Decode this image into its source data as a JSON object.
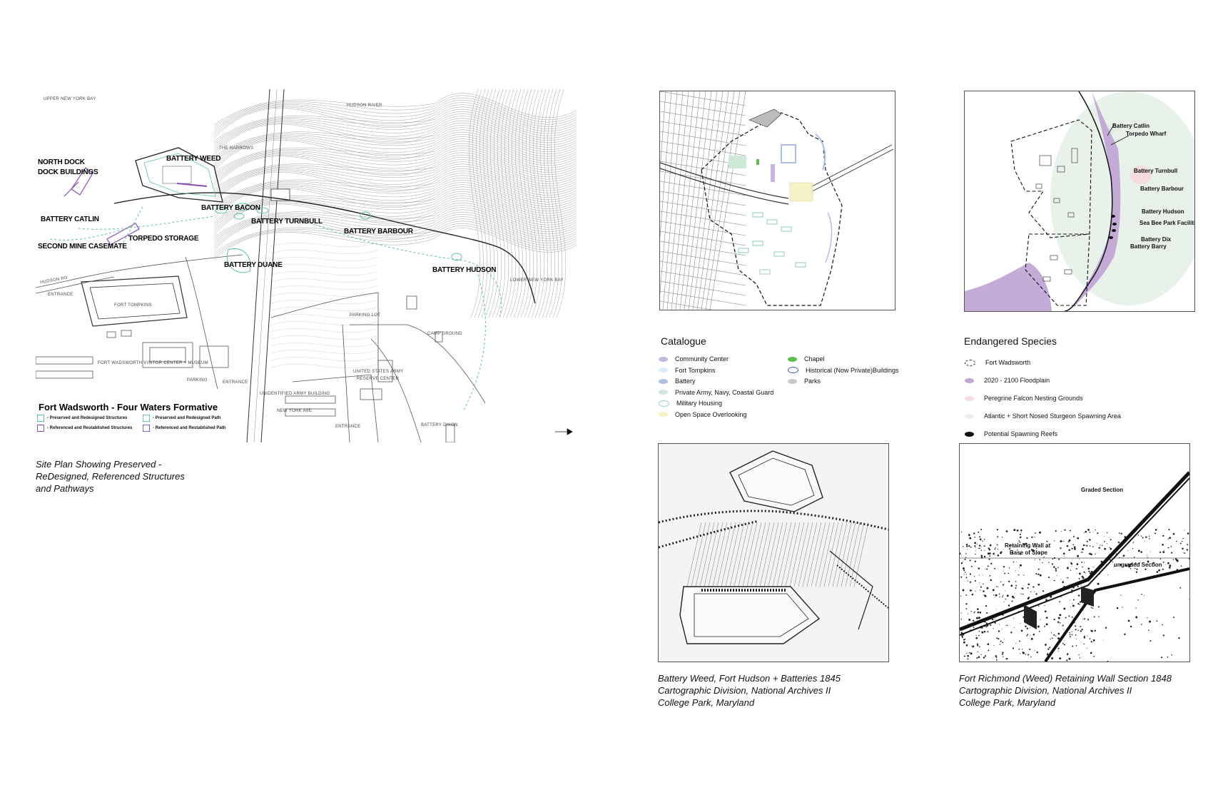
{
  "site_plan": {
    "title": "Fort Wadsworth - Four Waters Formative",
    "labels": {
      "north_dock": "NORTH DOCK",
      "dock_buildings": "DOCK BUILDINGS",
      "battery_weed": "BATTERY WEED",
      "battery_catlin": "BATTERY CATLIN",
      "battery_bacon": "BATTERY BACON",
      "battery_turnbull": "BATTERY TURNBULL",
      "battery_barbour": "BATTERY BARBOUR",
      "torpedo_storage": "TORPEDO STORAGE",
      "second_mine_casemate": "SECOND MINE CASEMATE",
      "battery_duane": "BATTERY DUANE",
      "battery_hudson": "BATTERY HUDSON"
    },
    "small_labels": {
      "upper_bay": "UPPER NEW YORK BAY",
      "hudson_river": "HUDSON RIVER",
      "the_narrows": "THE NARROWS",
      "lower_bay": "LOWER NEW YORK BAY",
      "hudson_rd": "HUDSON RD",
      "entrance_1": "ENTRANCE",
      "entrance_2": "ENTRANCE",
      "entrance_3": "ENTRANCE",
      "fort_tompkins": "FORT TOMPKINS",
      "parking_lot": "PARKING LOT",
      "camp_ground": "CAMP GROUND",
      "visitor_center": "FORT WADSWORTH VISITOR CENTER + MUSEUM",
      "parking": "PARKING",
      "unidentified_building": "UNIDENTIFIED ARMY BUILDING",
      "army_reserve_1": "UNITED STATES ARMY",
      "army_reserve_2": "RESERVE CENTER",
      "new_york_ave": "NEW YORK AVE",
      "battery_dixon": "BATTERY DIXON"
    },
    "legend": [
      {
        "label": "- Preserved and Redesigned Structures",
        "color": "#5fbfa0",
        "style": "solid"
      },
      {
        "label": "- Preserved and Redesigned Path",
        "color": "#5fbfa0",
        "style": "dashed"
      },
      {
        "label": "- Referenced and Restablished Structures",
        "color": "#8a4fb0",
        "style": "solid"
      },
      {
        "label": "- Referenced and Restablished Path",
        "color": "#8a4fb0",
        "style": "dashed"
      }
    ],
    "caption": [
      "Site Plan Showing Preserved -",
      "ReDesigned, Referenced Structures",
      "and Pathways"
    ]
  },
  "catalogue": {
    "title": "Catalogue",
    "items": [
      {
        "label": "Community Center",
        "color": "#c9b6dc"
      },
      {
        "label": "Fort Tompkins",
        "color": "#d7ecf8"
      },
      {
        "label": "Battery",
        "color": "#aebfe6"
      },
      {
        "label": "Private Army, Navy, Coastal Guard",
        "color": "#cfe9d9"
      },
      {
        "label": "Military Housing",
        "color": "#ffffff",
        "outline": "#8fcfad"
      },
      {
        "label": "Open Space Overlooking",
        "color": "#f7f3c8"
      },
      {
        "label": "Chapel",
        "color": "#5cbf4e"
      },
      {
        "label": "Historical (Now Private)Buildings",
        "color": "#ffffff",
        "outline": "#3a55b8"
      },
      {
        "label": "Parks",
        "color": "#c8c8c8"
      }
    ]
  },
  "species": {
    "title": "Endangered Species",
    "items": [
      {
        "label": "Fort Wadsworth",
        "color": "#ffffff",
        "outline": "#222222"
      },
      {
        "label": "2020 - 2100 Floodplain",
        "color": "#c2a6d6"
      },
      {
        "label": "Peregrine Falcon Nesting Grounds",
        "color": "#f6dce0"
      },
      {
        "label": "Atlantic + Short Nosed Sturgeon Spawning Area",
        "color": "#e8f1ea"
      },
      {
        "label": "Potential Spawning Reefs",
        "color": "#111111"
      }
    ],
    "map_labels": {
      "catlin": "Battery Catlin",
      "torpedo": "Torpedo Wharf",
      "turnbull": "Battery Turnbull",
      "barbour": "Battery Barbour",
      "hudson": "Battery Hudson",
      "seabee": "Sea Bee Park Facilities",
      "dix": "Battery Dix",
      "barry": "Battery Barry"
    }
  },
  "archive_1": {
    "caption": [
      "Battery Weed, Fort Hudson + Batteries 1845",
      "Cartographic Division, National Archives II",
      "College Park, Maryland"
    ]
  },
  "archive_2": {
    "labels": {
      "graded": "Graded Section",
      "retaining_1": "Retaining Wall at",
      "retaining_2": "Base of Slope",
      "ungraded": "ungraded Section"
    },
    "caption": [
      "Fort Richmond (Weed) Retaining Wall Section 1848",
      "Cartographic Division, National Archives II",
      "College Park, Maryland"
    ]
  }
}
